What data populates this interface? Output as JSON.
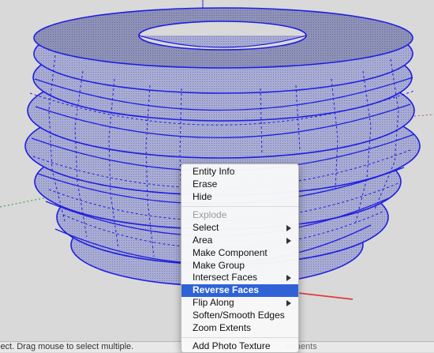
{
  "viewport": {
    "background_color": "#d9d9d9",
    "model_name": "ribbed-torus-selected",
    "selection_color": "#1f1fe0",
    "face_color": "#a9acd4"
  },
  "context_menu": {
    "items": [
      {
        "label": "Entity Info",
        "enabled": true
      },
      {
        "label": "Erase",
        "enabled": true
      },
      {
        "label": "Hide",
        "enabled": true
      },
      {
        "separator": true
      },
      {
        "label": "Explode",
        "enabled": false
      },
      {
        "label": "Select",
        "enabled": true,
        "submenu": true
      },
      {
        "label": "Area",
        "enabled": true,
        "submenu": true
      },
      {
        "label": "Make Component",
        "enabled": true
      },
      {
        "label": "Make Group",
        "enabled": true
      },
      {
        "label": "Intersect Faces",
        "enabled": true,
        "submenu": true
      },
      {
        "label": "Reverse Faces",
        "enabled": true,
        "selected": true
      },
      {
        "label": "Flip Along",
        "enabled": true,
        "submenu": true
      },
      {
        "label": "Soften/Smooth Edges",
        "enabled": true
      },
      {
        "label": "Zoom Extents",
        "enabled": true
      },
      {
        "separator": true
      },
      {
        "label": "Add Photo Texture",
        "enabled": true
      }
    ]
  },
  "annotation": {
    "type": "arrow",
    "color": "#e23b3b",
    "points_to": "Reverse Faces"
  },
  "statusbar": {
    "left_text": "lect. Drag mouse to select multiple.",
    "right_text": "rements"
  }
}
